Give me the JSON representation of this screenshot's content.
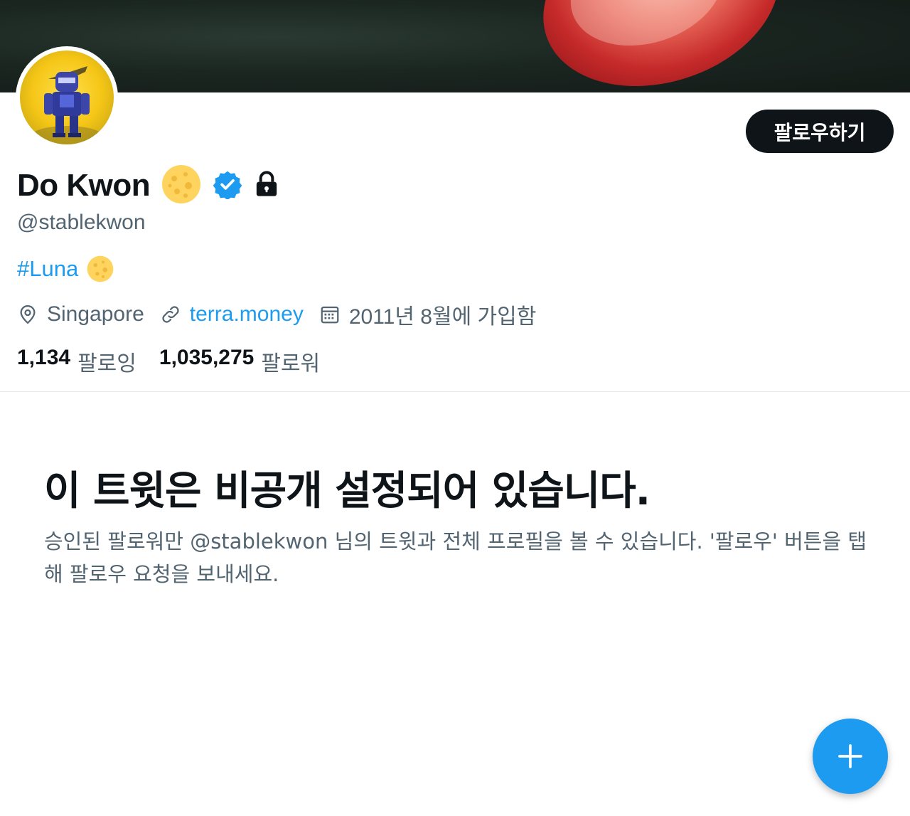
{
  "profile": {
    "name": "Do Kwon",
    "handle": "@stablekwon",
    "bio_hashtag": "#Luna",
    "location": "Singapore",
    "website": "terra.money",
    "joined": "2011년 8월에 가입함",
    "verified": true,
    "protected": true
  },
  "stats": {
    "following_count": "1,134",
    "following_label": "팔로잉",
    "followers_count": "1,035,275",
    "followers_label": "팔로워"
  },
  "actions": {
    "follow_label": "팔로우하기"
  },
  "protected_notice": {
    "title": "이 트윗은 비공개 설정되어 있습니다.",
    "description": "승인된 팔로워만 @stablekwon 님의 트윗과 전체 프로필을 볼 수 있습니다. '팔로우' 버튼을 탭해 팔로우 요청을 보내세요."
  },
  "colors": {
    "accent": "#1d9bf0",
    "text_primary": "#0f1419",
    "text_secondary": "#536471",
    "button_dark": "#0f1419",
    "moon_emoji": "#ffd45e"
  },
  "icons": {
    "location": "location-pin-icon",
    "link": "link-icon",
    "calendar": "calendar-icon",
    "verified": "verified-badge-icon",
    "lock": "lock-icon",
    "moon": "moon-emoji-icon",
    "compose": "plus-icon"
  }
}
